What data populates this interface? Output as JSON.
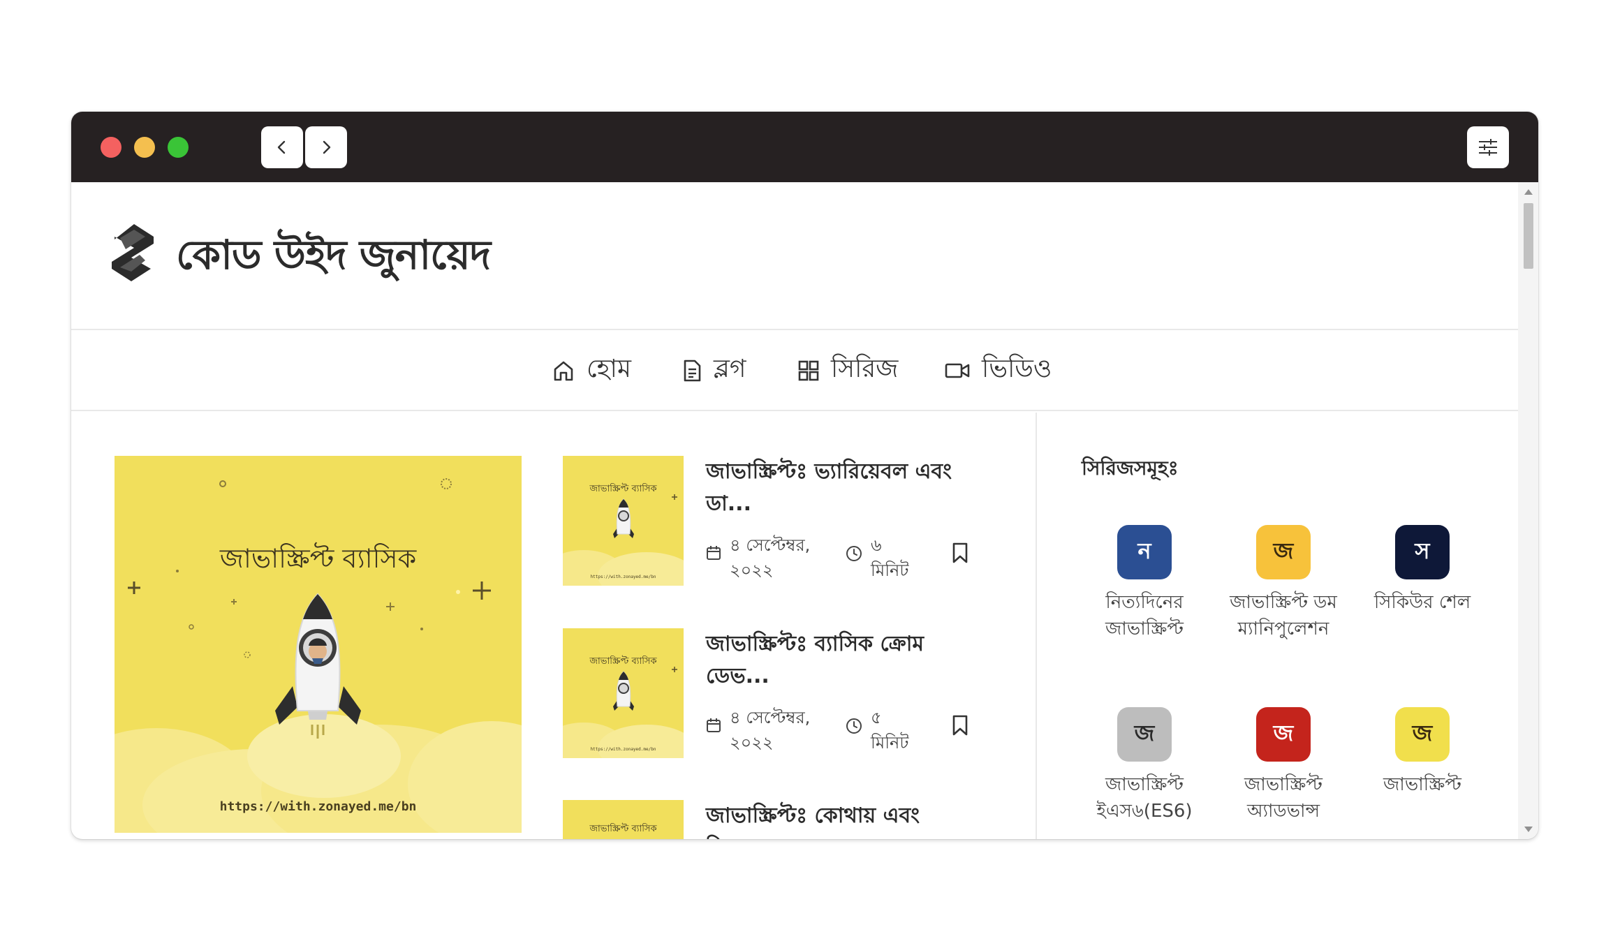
{
  "site": {
    "title": "কোড উইদ জুনায়েদ"
  },
  "nav": {
    "items": [
      {
        "label": "হোম",
        "icon": "home-icon"
      },
      {
        "label": "ব্লগ",
        "icon": "document-icon"
      },
      {
        "label": "সিরিজ",
        "icon": "grid-icon"
      },
      {
        "label": "ভিডিও",
        "icon": "video-icon"
      }
    ]
  },
  "featured": {
    "title": "জাভাস্ক্রিপ্ট ব্যাসিক",
    "url": "https://with.zonayed.me/bn"
  },
  "posts": [
    {
      "title": "জাভাস্ক্রিপ্টঃ ভ্যারিয়েবল এবং ডা...",
      "date": "৪ সেপ্টেম্বর, ২০২২",
      "read_time": "৬ মিনিট",
      "thumb_label": "জাভাস্ক্রিপ্ট ব্যাসিক",
      "thumb_url": "https://with.zonayed.me/bn"
    },
    {
      "title": "জাভাস্ক্রিপ্টঃ ব্যাসিক ক্রোম ডেভ...",
      "date": "৪ সেপ্টেম্বর, ২০২২",
      "read_time": "৫ মিনিট",
      "thumb_label": "জাভাস্ক্রিপ্ট ব্যাসিক",
      "thumb_url": "https://with.zonayed.me/bn"
    },
    {
      "title": "জাভাস্ক্রিপ্টঃ কোথায় এবং কিভাবে",
      "date": "",
      "read_time": "",
      "thumb_label": "জাভাস্ক্রিপ্ট ব্যাসিক",
      "thumb_url": ""
    }
  ],
  "sidebar": {
    "title": "সিরিজসমূহঃ",
    "series": [
      {
        "badge": "ন",
        "label": "নিত্যদিনের জাভাস্ক্রিপ্ট",
        "bg": "#2b4f93",
        "fg": "#ffffff"
      },
      {
        "badge": "জ",
        "label": "জাভাস্ক্রিপ্ট ডম ম্যানিপুলেশন",
        "bg": "#f7c23b",
        "fg": "#3a2a10"
      },
      {
        "badge": "স",
        "label": "সিকিউর শেল",
        "bg": "#0e1838",
        "fg": "#ffffff"
      },
      {
        "badge": "জ",
        "label": "জাভাস্ক্রিপ্ট ইএস৬(ES6)",
        "bg": "#bdbdbd",
        "fg": "#2a2a2a"
      },
      {
        "badge": "জ",
        "label": "জাভাস্ক্রিপ্ট অ্যাডভান্স",
        "bg": "#c4241c",
        "fg": "#ffffff"
      },
      {
        "badge": "জ",
        "label": "জাভাস্ক্রিপ্ট",
        "bg": "#f1df4c",
        "fg": "#3a2a10"
      }
    ]
  }
}
